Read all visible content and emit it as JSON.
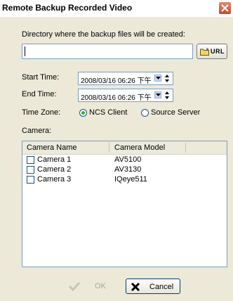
{
  "window": {
    "title": "Remote Backup Recorded Video"
  },
  "directory": {
    "label": "Directory where the backup files will be created:",
    "value": "",
    "browse_label": "URL"
  },
  "start_time": {
    "label": "Start Time:",
    "value": "2008/03/16 06:26 下午"
  },
  "end_time": {
    "label": "End Time:",
    "value": "2008/03/16 06:26 下午"
  },
  "time_zone": {
    "label": "Time Zone:",
    "options": [
      "NCS Client",
      "Source Server"
    ],
    "selected": "NCS Client"
  },
  "camera": {
    "label": "Camera:",
    "columns": [
      "Camera Name",
      "Camera Model"
    ],
    "rows": [
      {
        "name": "Camera 1",
        "model": "AV5100",
        "checked": false
      },
      {
        "name": "Camera 2",
        "model": "AV3130",
        "checked": false
      },
      {
        "name": "Camera 3",
        "model": "IQeye511",
        "checked": false
      }
    ]
  },
  "buttons": {
    "ok_label": "OK",
    "cancel_label": "Cancel",
    "ok_enabled": false
  },
  "colors": {
    "titlebar": "#ffffff",
    "dialog_bg": "#ece9d8",
    "close": "#c4482c",
    "radio_on": "#2bb02b"
  }
}
